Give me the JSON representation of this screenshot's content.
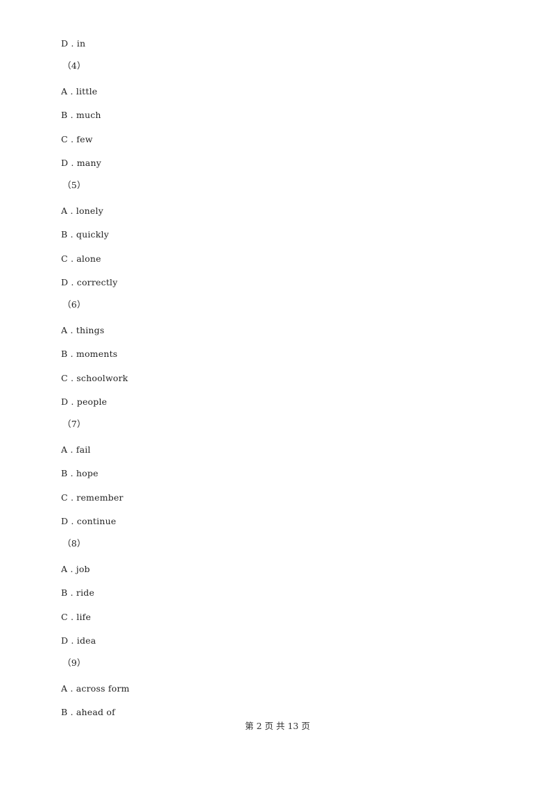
{
  "lines": [
    {
      "type": "option",
      "text": "D . in"
    },
    {
      "type": "question",
      "text": "（4）"
    },
    {
      "type": "option",
      "text": "A . little"
    },
    {
      "type": "option",
      "text": "B . much"
    },
    {
      "type": "option",
      "text": "C . few"
    },
    {
      "type": "option",
      "text": "D . many"
    },
    {
      "type": "question",
      "text": "（5）"
    },
    {
      "type": "option",
      "text": "A . lonely"
    },
    {
      "type": "option",
      "text": "B . quickly"
    },
    {
      "type": "option",
      "text": "C . alone"
    },
    {
      "type": "option",
      "text": "D . correctly"
    },
    {
      "type": "question",
      "text": "（6）"
    },
    {
      "type": "option",
      "text": "A . things"
    },
    {
      "type": "option",
      "text": "B . moments"
    },
    {
      "type": "option",
      "text": "C . schoolwork"
    },
    {
      "type": "option",
      "text": "D . people"
    },
    {
      "type": "question",
      "text": "（7）"
    },
    {
      "type": "option",
      "text": "A . fail"
    },
    {
      "type": "option",
      "text": "B . hope"
    },
    {
      "type": "option",
      "text": "C . remember"
    },
    {
      "type": "option",
      "text": "D . continue"
    },
    {
      "type": "question",
      "text": "（8）"
    },
    {
      "type": "option",
      "text": "A . job"
    },
    {
      "type": "option",
      "text": "B . ride"
    },
    {
      "type": "option",
      "text": "C . life"
    },
    {
      "type": "option",
      "text": "D . idea"
    },
    {
      "type": "question",
      "text": "（9）"
    },
    {
      "type": "option",
      "text": "A . across form"
    },
    {
      "type": "option",
      "text": "B . ahead of"
    }
  ],
  "footer": {
    "text": "第 2 页 共 13 页"
  }
}
